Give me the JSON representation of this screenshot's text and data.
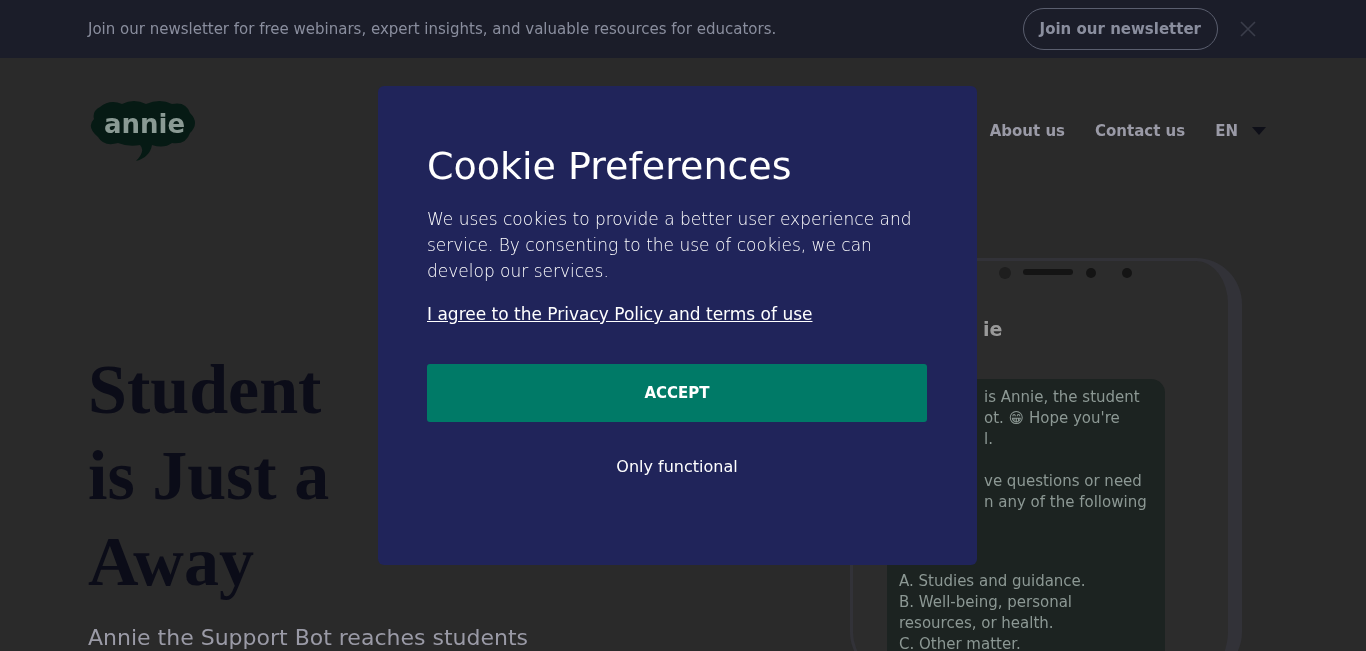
{
  "banner": {
    "text": "Join our newsletter for free webinars, expert insights, and valuable resources for educators.",
    "button": "Join our newsletter"
  },
  "logo": {
    "text": "annie"
  },
  "nav": {
    "items": [
      "About us",
      "Contact us"
    ],
    "language": "EN"
  },
  "hero": {
    "heading_lines": [
      "Student",
      "is Just a",
      "Away"
    ],
    "subtitle": "Annie the Support Bot reaches students"
  },
  "phone": {
    "chat_title": "ie",
    "bubble_paragraphs": [
      [
        "is Annie, the student",
        "ot. 😁 Hope you're",
        "l."
      ],
      [
        "ve questions or need",
        "n any of the following"
      ]
    ],
    "options": [
      "A. Studies and guidance.",
      "B. Well-being, personal resources, or health.",
      "C. Other matter."
    ]
  },
  "cookie_dialog": {
    "title": "Cookie Preferences",
    "body": "We uses cookies to provide a better user experience and service. By consenting to the use of cookies, we can develop our services.",
    "link": "I agree to the Privacy Policy and terms of use",
    "accept": "ACCEPT",
    "secondary": "Only functional"
  }
}
